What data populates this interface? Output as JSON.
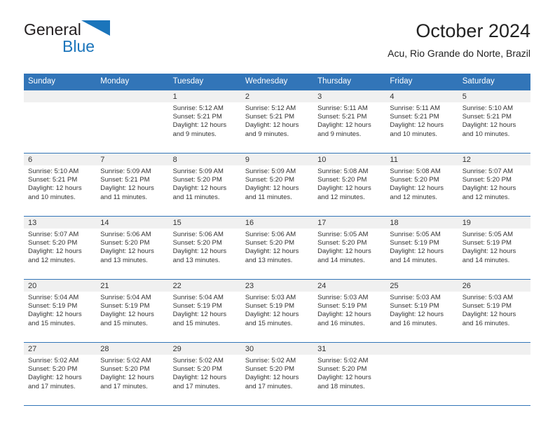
{
  "brand": {
    "name_part1": "General",
    "name_part2": "Blue",
    "triangle_icon": "triangle-icon",
    "color_dark": "#231f20",
    "color_blue": "#1b75bb"
  },
  "header": {
    "title": "October 2024",
    "subtitle": "Acu, Rio Grande do Norte, Brazil"
  },
  "theme": {
    "header_blue": "#3275b8",
    "daynum_band": "#f0f0f0",
    "text": "#333333"
  },
  "calendar": {
    "weekday_headers": [
      "Sunday",
      "Monday",
      "Tuesday",
      "Wednesday",
      "Thursday",
      "Friday",
      "Saturday"
    ],
    "weeks": [
      [
        {
          "day": "",
          "sunrise": "",
          "sunset": "",
          "daylight_1": "",
          "daylight_2": ""
        },
        {
          "day": "",
          "sunrise": "",
          "sunset": "",
          "daylight_1": "",
          "daylight_2": ""
        },
        {
          "day": "1",
          "sunrise": "Sunrise: 5:12 AM",
          "sunset": "Sunset: 5:21 PM",
          "daylight_1": "Daylight: 12 hours",
          "daylight_2": "and 9 minutes."
        },
        {
          "day": "2",
          "sunrise": "Sunrise: 5:12 AM",
          "sunset": "Sunset: 5:21 PM",
          "daylight_1": "Daylight: 12 hours",
          "daylight_2": "and 9 minutes."
        },
        {
          "day": "3",
          "sunrise": "Sunrise: 5:11 AM",
          "sunset": "Sunset: 5:21 PM",
          "daylight_1": "Daylight: 12 hours",
          "daylight_2": "and 9 minutes."
        },
        {
          "day": "4",
          "sunrise": "Sunrise: 5:11 AM",
          "sunset": "Sunset: 5:21 PM",
          "daylight_1": "Daylight: 12 hours",
          "daylight_2": "and 10 minutes."
        },
        {
          "day": "5",
          "sunrise": "Sunrise: 5:10 AM",
          "sunset": "Sunset: 5:21 PM",
          "daylight_1": "Daylight: 12 hours",
          "daylight_2": "and 10 minutes."
        }
      ],
      [
        {
          "day": "6",
          "sunrise": "Sunrise: 5:10 AM",
          "sunset": "Sunset: 5:21 PM",
          "daylight_1": "Daylight: 12 hours",
          "daylight_2": "and 10 minutes."
        },
        {
          "day": "7",
          "sunrise": "Sunrise: 5:09 AM",
          "sunset": "Sunset: 5:21 PM",
          "daylight_1": "Daylight: 12 hours",
          "daylight_2": "and 11 minutes."
        },
        {
          "day": "8",
          "sunrise": "Sunrise: 5:09 AM",
          "sunset": "Sunset: 5:20 PM",
          "daylight_1": "Daylight: 12 hours",
          "daylight_2": "and 11 minutes."
        },
        {
          "day": "9",
          "sunrise": "Sunrise: 5:09 AM",
          "sunset": "Sunset: 5:20 PM",
          "daylight_1": "Daylight: 12 hours",
          "daylight_2": "and 11 minutes."
        },
        {
          "day": "10",
          "sunrise": "Sunrise: 5:08 AM",
          "sunset": "Sunset: 5:20 PM",
          "daylight_1": "Daylight: 12 hours",
          "daylight_2": "and 12 minutes."
        },
        {
          "day": "11",
          "sunrise": "Sunrise: 5:08 AM",
          "sunset": "Sunset: 5:20 PM",
          "daylight_1": "Daylight: 12 hours",
          "daylight_2": "and 12 minutes."
        },
        {
          "day": "12",
          "sunrise": "Sunrise: 5:07 AM",
          "sunset": "Sunset: 5:20 PM",
          "daylight_1": "Daylight: 12 hours",
          "daylight_2": "and 12 minutes."
        }
      ],
      [
        {
          "day": "13",
          "sunrise": "Sunrise: 5:07 AM",
          "sunset": "Sunset: 5:20 PM",
          "daylight_1": "Daylight: 12 hours",
          "daylight_2": "and 12 minutes."
        },
        {
          "day": "14",
          "sunrise": "Sunrise: 5:06 AM",
          "sunset": "Sunset: 5:20 PM",
          "daylight_1": "Daylight: 12 hours",
          "daylight_2": "and 13 minutes."
        },
        {
          "day": "15",
          "sunrise": "Sunrise: 5:06 AM",
          "sunset": "Sunset: 5:20 PM",
          "daylight_1": "Daylight: 12 hours",
          "daylight_2": "and 13 minutes."
        },
        {
          "day": "16",
          "sunrise": "Sunrise: 5:06 AM",
          "sunset": "Sunset: 5:20 PM",
          "daylight_1": "Daylight: 12 hours",
          "daylight_2": "and 13 minutes."
        },
        {
          "day": "17",
          "sunrise": "Sunrise: 5:05 AM",
          "sunset": "Sunset: 5:20 PM",
          "daylight_1": "Daylight: 12 hours",
          "daylight_2": "and 14 minutes."
        },
        {
          "day": "18",
          "sunrise": "Sunrise: 5:05 AM",
          "sunset": "Sunset: 5:19 PM",
          "daylight_1": "Daylight: 12 hours",
          "daylight_2": "and 14 minutes."
        },
        {
          "day": "19",
          "sunrise": "Sunrise: 5:05 AM",
          "sunset": "Sunset: 5:19 PM",
          "daylight_1": "Daylight: 12 hours",
          "daylight_2": "and 14 minutes."
        }
      ],
      [
        {
          "day": "20",
          "sunrise": "Sunrise: 5:04 AM",
          "sunset": "Sunset: 5:19 PM",
          "daylight_1": "Daylight: 12 hours",
          "daylight_2": "and 15 minutes."
        },
        {
          "day": "21",
          "sunrise": "Sunrise: 5:04 AM",
          "sunset": "Sunset: 5:19 PM",
          "daylight_1": "Daylight: 12 hours",
          "daylight_2": "and 15 minutes."
        },
        {
          "day": "22",
          "sunrise": "Sunrise: 5:04 AM",
          "sunset": "Sunset: 5:19 PM",
          "daylight_1": "Daylight: 12 hours",
          "daylight_2": "and 15 minutes."
        },
        {
          "day": "23",
          "sunrise": "Sunrise: 5:03 AM",
          "sunset": "Sunset: 5:19 PM",
          "daylight_1": "Daylight: 12 hours",
          "daylight_2": "and 15 minutes."
        },
        {
          "day": "24",
          "sunrise": "Sunrise: 5:03 AM",
          "sunset": "Sunset: 5:19 PM",
          "daylight_1": "Daylight: 12 hours",
          "daylight_2": "and 16 minutes."
        },
        {
          "day": "25",
          "sunrise": "Sunrise: 5:03 AM",
          "sunset": "Sunset: 5:19 PM",
          "daylight_1": "Daylight: 12 hours",
          "daylight_2": "and 16 minutes."
        },
        {
          "day": "26",
          "sunrise": "Sunrise: 5:03 AM",
          "sunset": "Sunset: 5:19 PM",
          "daylight_1": "Daylight: 12 hours",
          "daylight_2": "and 16 minutes."
        }
      ],
      [
        {
          "day": "27",
          "sunrise": "Sunrise: 5:02 AM",
          "sunset": "Sunset: 5:20 PM",
          "daylight_1": "Daylight: 12 hours",
          "daylight_2": "and 17 minutes."
        },
        {
          "day": "28",
          "sunrise": "Sunrise: 5:02 AM",
          "sunset": "Sunset: 5:20 PM",
          "daylight_1": "Daylight: 12 hours",
          "daylight_2": "and 17 minutes."
        },
        {
          "day": "29",
          "sunrise": "Sunrise: 5:02 AM",
          "sunset": "Sunset: 5:20 PM",
          "daylight_1": "Daylight: 12 hours",
          "daylight_2": "and 17 minutes."
        },
        {
          "day": "30",
          "sunrise": "Sunrise: 5:02 AM",
          "sunset": "Sunset: 5:20 PM",
          "daylight_1": "Daylight: 12 hours",
          "daylight_2": "and 17 minutes."
        },
        {
          "day": "31",
          "sunrise": "Sunrise: 5:02 AM",
          "sunset": "Sunset: 5:20 PM",
          "daylight_1": "Daylight: 12 hours",
          "daylight_2": "and 18 minutes."
        },
        {
          "day": "",
          "sunrise": "",
          "sunset": "",
          "daylight_1": "",
          "daylight_2": ""
        },
        {
          "day": "",
          "sunrise": "",
          "sunset": "",
          "daylight_1": "",
          "daylight_2": ""
        }
      ]
    ]
  }
}
